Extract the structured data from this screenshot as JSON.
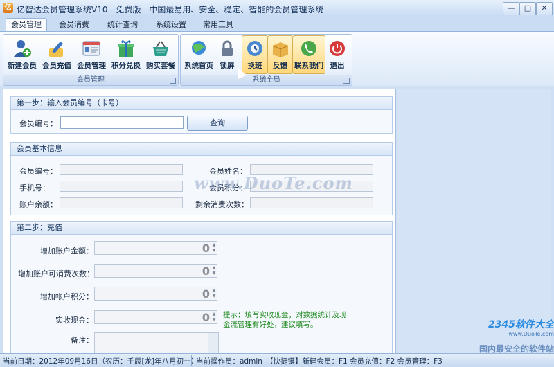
{
  "window": {
    "title": "亿智达会员管理系统V10 - 免费版 - 中国最易用、安全、稳定、智能的会员管理系统",
    "app_icon": "亿",
    "min": "—",
    "max": "□",
    "close": "✕"
  },
  "tabs": [
    {
      "label": "会员管理",
      "active": true
    },
    {
      "label": "会员消费"
    },
    {
      "label": "统计查询"
    },
    {
      "label": "系统设置"
    },
    {
      "label": "常用工具"
    }
  ],
  "ribbon": {
    "group1": {
      "label": "会员管理",
      "buttons": [
        "新建会员",
        "会员充值",
        "会员管理",
        "积分兑换",
        "购买套餐"
      ]
    },
    "group2": {
      "label": "系统全局",
      "buttons": [
        "系统首页",
        "锁屏",
        "换班",
        "反馈",
        "联系我们",
        "退出"
      ]
    }
  },
  "step1": {
    "title": "第一步：输入会员编号（卡号）",
    "member_no_label": "会员编号：",
    "query_button": "查询"
  },
  "basic": {
    "title": "会员基本信息",
    "member_no": "会员编号：",
    "name": "会员姓名：",
    "phone": "手机号：",
    "points": "会员积分：",
    "balance": "账户余额：",
    "remaining": "剩余消费次数："
  },
  "step2": {
    "title": "第二步：充值",
    "add_amount": "增加账户金额：",
    "add_times": "增加账户可消费次数：",
    "add_points": "增加帐户积分：",
    "cash": "实收现金：",
    "remark": "备注：",
    "value_amount": "0",
    "value_times": "0",
    "value_points": "0",
    "value_cash": "0",
    "hint": "提示：填写实收现金，对数据统计及现金流管理有好处，建议填写。"
  },
  "status": {
    "date": "当前日期：2012年09月16日（农历：壬辰[龙]年八月初一）",
    "operator": "当前操作员：admin",
    "hotkeys": "【快捷键】新建会员：F1  会员充值：F2  会员管理：F3"
  },
  "watermarks": {
    "center": "www.DuoTe.com",
    "corner1": "2345软件大全",
    "corner2": "www.DuoTe.com",
    "corner3": "国内最安全的软件站"
  },
  "colors": {
    "accent": "#1f8a1f",
    "ribbon_highlight": "#ffd77a"
  }
}
